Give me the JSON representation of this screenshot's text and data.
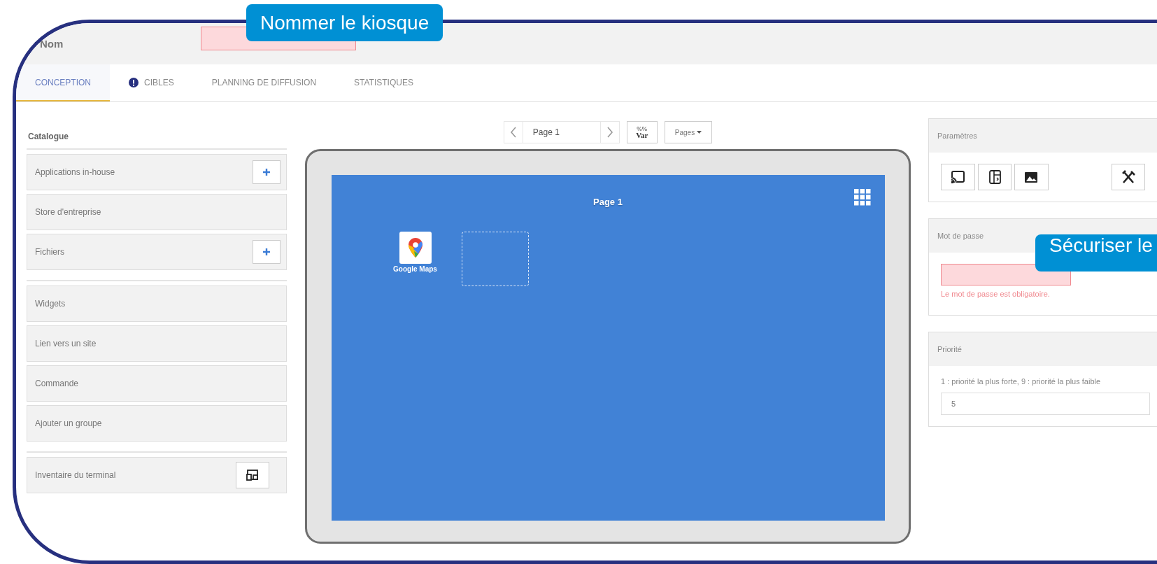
{
  "callouts": [
    {
      "text": "Nommer le kiosque"
    },
    {
      "text": "Sécuriser le"
    }
  ],
  "header": {
    "label": "Nom",
    "name_field": {
      "invalid": true
    }
  },
  "tabs": [
    {
      "label": "CONCEPTION",
      "selected": true,
      "warning": false
    },
    {
      "label": "CIBLES",
      "selected": false,
      "warning": true
    },
    {
      "label": "PLANNING DE DIFFUSION",
      "selected": false,
      "warning": false
    },
    {
      "label": "STATISTIQUES",
      "selected": false,
      "warning": false
    }
  ],
  "catalogue": {
    "title": "Catalogue",
    "groups": [
      [
        {
          "label": "Applications in-house",
          "kind": "add"
        },
        {
          "label": "Store d'entreprise",
          "kind": "plain"
        },
        {
          "label": "Fichiers",
          "kind": "add"
        }
      ],
      [
        {
          "label": "Widgets",
          "kind": "plain"
        },
        {
          "label": "Lien vers un site",
          "kind": "plain"
        },
        {
          "label": "Commande",
          "kind": "plain"
        },
        {
          "label": "Ajouter un groupe",
          "kind": "plain"
        }
      ],
      [
        {
          "label": "Inventaire du terminal",
          "kind": "inventory"
        }
      ]
    ]
  },
  "pager": {
    "page": "Page 1",
    "var_top": "%%",
    "var_bottom": "Var",
    "menu": "Pages"
  },
  "canvas": {
    "title": "Page 1",
    "items": [
      {
        "kind": "app",
        "label": "Google Maps"
      },
      {
        "kind": "slot"
      }
    ]
  },
  "settings": {
    "title": "Paramètres"
  },
  "password": {
    "title": "Mot de passe",
    "invalid": true,
    "error": "Le mot de passe est obligatoire."
  },
  "priority": {
    "title": "Priorité",
    "hint": "1 : priorité la plus forte, 9 : priorité la plus faible",
    "value": "5"
  }
}
